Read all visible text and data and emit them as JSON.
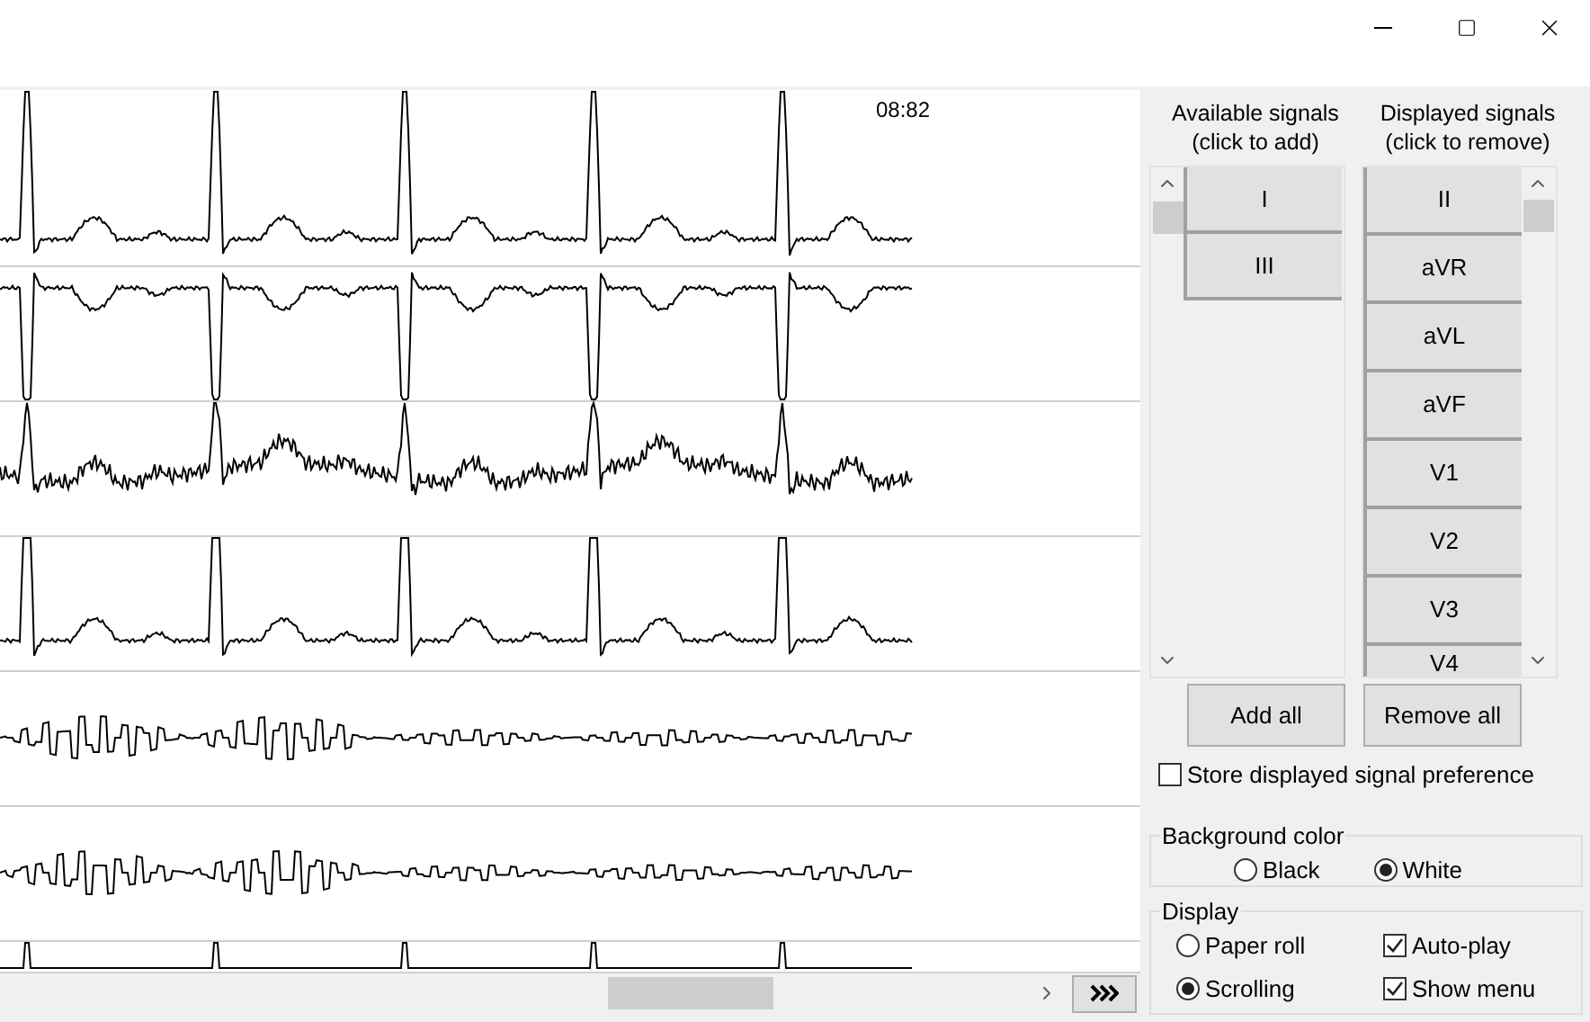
{
  "time_label": "08:82",
  "strips": [
    {
      "kind": "normal"
    },
    {
      "kind": "inverted"
    },
    {
      "kind": "noisy"
    },
    {
      "kind": "normal"
    },
    {
      "kind": "steps"
    },
    {
      "kind": "steps"
    },
    {
      "kind": "spikes"
    }
  ],
  "available_signals": {
    "heading": [
      "Available signals",
      "(click to add)"
    ],
    "items": [
      "I",
      "III"
    ]
  },
  "displayed_signals": {
    "heading": [
      "Displayed signals",
      "(click to remove)"
    ],
    "items": [
      "II",
      "aVR",
      "aVL",
      "aVF",
      "V1",
      "V2",
      "V3",
      "V4"
    ]
  },
  "buttons": [
    "Add all",
    "Remove all"
  ],
  "store_preference": {
    "label": "Store displayed signal preference",
    "checked": false
  },
  "background_color": {
    "title": "Background color",
    "options": [
      {
        "label": "Black",
        "selected": false
      },
      {
        "label": "White",
        "selected": true
      }
    ]
  },
  "display": {
    "title": "Display",
    "modes": [
      {
        "label": "Paper roll",
        "selected": false
      },
      {
        "label": "Scrolling",
        "selected": true
      }
    ],
    "options": [
      {
        "label": "Auto-play",
        "checked": true
      },
      {
        "label": "Show menu",
        "checked": true
      }
    ]
  }
}
